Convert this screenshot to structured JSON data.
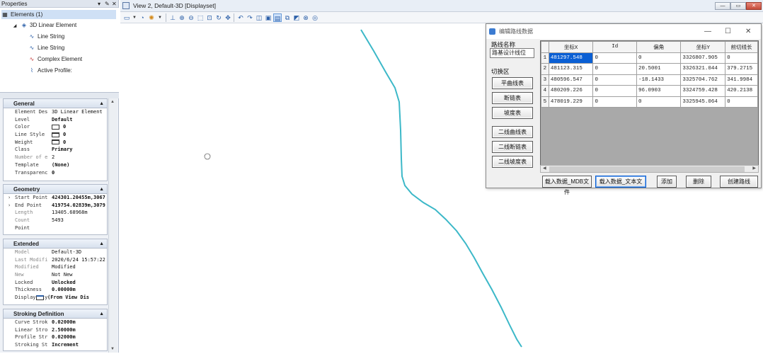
{
  "properties": {
    "title": "Properties",
    "controls": [
      "▾",
      "✎",
      "✕"
    ],
    "tree": {
      "root": "Elements (1)",
      "child": "3D Linear Element",
      "items": [
        "Line String",
        "Line String",
        "Complex Element",
        "Active Profile:"
      ]
    },
    "sections": [
      {
        "title": "General",
        "rows": [
          {
            "key": "Element Des",
            "value": "3D Linear Element",
            "dim": false
          },
          {
            "key": "Level",
            "value": "Default",
            "dim": false
          },
          {
            "key": "Color",
            "value": "0",
            "swatch": true,
            "dim": false
          },
          {
            "key": "Line Style",
            "value": "0",
            "swatch": true,
            "dim": false
          },
          {
            "key": "Weight",
            "value": "0",
            "swatch": true,
            "dim": false
          },
          {
            "key": "Class",
            "value": "Primary",
            "dim": false
          },
          {
            "key": "Number of e",
            "value": "2",
            "dim": true
          },
          {
            "key": "Template",
            "value": "(None)",
            "dim": false
          },
          {
            "key": "Transparenc",
            "value": "0",
            "dim": false
          }
        ]
      },
      {
        "title": "Geometry",
        "rows": [
          {
            "key": "Start Point",
            "value": "424301.20455m,3067",
            "expand": true,
            "dim": false
          },
          {
            "key": "End Point",
            "value": "419754.02839m,3079",
            "expand": true,
            "dim": false
          },
          {
            "key": "Length",
            "value": "13405.68968m",
            "dim": true
          },
          {
            "key": "Count",
            "value": "5493",
            "dim": true
          },
          {
            "key": "Point",
            "value": "",
            "dim": false
          }
        ]
      },
      {
        "title": "Extended",
        "rows": [
          {
            "key": "Model",
            "value": "Default-3D",
            "dim": true
          },
          {
            "key": "Last Modifi",
            "value": "2020/6/24 15:57:22",
            "dim": true
          },
          {
            "key": "Modified",
            "value": "Modified",
            "dim": true
          },
          {
            "key": "New",
            "value": "Not New",
            "dim": true
          },
          {
            "key": "Locked",
            "value": "Unlocked",
            "dim": false
          },
          {
            "key": "Thickness",
            "value": "0.00000m",
            "dim": false
          },
          {
            "key": "Display Sty",
            "value": "(From View Dis",
            "swatch": true,
            "dim": false
          }
        ]
      },
      {
        "title": "Stroking Definition",
        "rows": [
          {
            "key": "Curve Strok",
            "value": "0.02000m",
            "dim": false
          },
          {
            "key": "Linear Stro",
            "value": "2.50000m",
            "dim": false
          },
          {
            "key": "Profile Str",
            "value": "0.02000m",
            "dim": false
          },
          {
            "key": "Stroking St",
            "value": "Increment",
            "dim": false
          }
        ]
      }
    ]
  },
  "view": {
    "title": "View 2, Default-3D [Displayset]",
    "window_controls": [
      "—",
      "▭",
      "✕"
    ],
    "toolbar_icons": [
      "view-attributes-icon",
      "dropdown-icon",
      "display-style-icon",
      "lighting-icon",
      "dropdown-icon",
      "levels-icon",
      "zoom-in-icon",
      "zoom-out-icon",
      "window-area-icon",
      "fit-view-icon",
      "rotate-view-icon",
      "pan-view-icon",
      "view-previous-icon",
      "view-next-icon",
      "standard-view-icon",
      "camera-icon",
      "clip-volume-icon",
      "clip-mask-icon",
      "copy-view-icon"
    ],
    "accent": "#3cb8c8"
  },
  "dialog": {
    "title": "编辑路线数据",
    "controls": [
      "—",
      "☐",
      "✕"
    ],
    "route_label": "路线名称",
    "route_value": "路基设计线位",
    "switch_label": "切换区",
    "left_buttons": [
      "平曲线表",
      "断链表",
      "坡度表",
      "二线曲线表",
      "二线断链表",
      "二线坡度表"
    ],
    "columns": [
      "坐标X",
      "Id",
      "偏角",
      "坐标Y",
      "前切线长"
    ],
    "rows": [
      {
        "n": "1",
        "x": "481297.548",
        "id": "0",
        "angle": "0",
        "y": "3326807.905",
        "t": "0"
      },
      {
        "n": "2",
        "x": "481123.315",
        "id": "0",
        "angle": "20.5001",
        "y": "3326321.044",
        "t": "379.2715"
      },
      {
        "n": "3",
        "x": "480596.547",
        "id": "0",
        "angle": "-18.1433",
        "y": "3325704.762",
        "t": "341.9984"
      },
      {
        "n": "4",
        "x": "480209.226",
        "id": "0",
        "angle": "96.0903",
        "y": "3324759.428",
        "t": "420.2138"
      },
      {
        "n": "5",
        "x": "478019.229",
        "id": "0",
        "angle": "0",
        "y": "3325945.064",
        "t": "0"
      }
    ],
    "bottom_buttons": [
      "载入数据_MDB文件",
      "载入数据_文本文",
      "添加",
      "删除",
      "创建路线"
    ]
  }
}
